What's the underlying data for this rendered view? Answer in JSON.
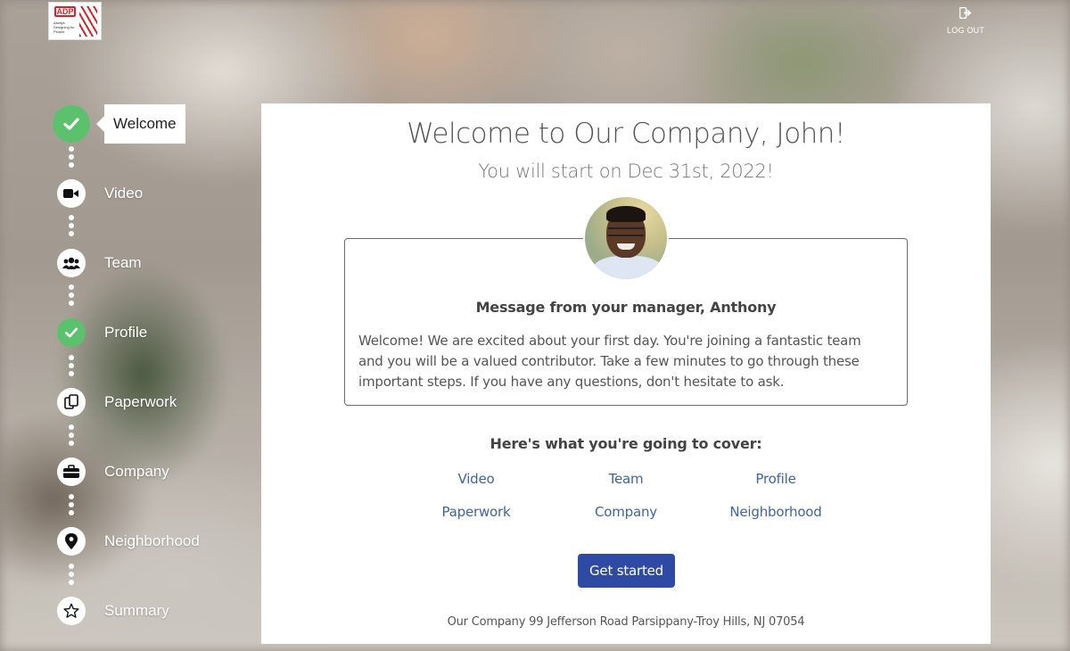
{
  "header": {
    "logo_text": "ADP",
    "logo_tagline": "Always Designing for People",
    "logout_label": "LOG OUT"
  },
  "sidebar": {
    "steps": [
      {
        "label": "Welcome",
        "icon": "check-icon",
        "state": "active-done"
      },
      {
        "label": "Video",
        "icon": "video-camera-icon",
        "state": "todo"
      },
      {
        "label": "Team",
        "icon": "users-icon",
        "state": "todo"
      },
      {
        "label": "Profile",
        "icon": "check-icon",
        "state": "done"
      },
      {
        "label": "Paperwork",
        "icon": "documents-icon",
        "state": "todo"
      },
      {
        "label": "Company",
        "icon": "briefcase-icon",
        "state": "todo"
      },
      {
        "label": "Neighborhood",
        "icon": "map-pin-icon",
        "state": "todo"
      },
      {
        "label": "Summary",
        "icon": "star-icon",
        "state": "todo"
      }
    ]
  },
  "main": {
    "title": "Welcome to Our Company, John!",
    "subtitle": "You will start on Dec 31st, 2022!",
    "message": {
      "heading": "Message from your manager, Anthony",
      "body": "Welcome! We are excited about your first day. You're joining a fantastic team and you will be a valued contributor. Take a few minutes to go through these important steps. If you have any questions, don't hesitate to ask."
    },
    "cover": {
      "heading": "Here's what you're going to cover:",
      "links": [
        "Video",
        "Team",
        "Profile",
        "Paperwork",
        "Company",
        "Neighborhood"
      ]
    },
    "get_started_label": "Get started",
    "footer": "Our Company 99 Jefferson Road Parsippany-Troy Hills, NJ 07054"
  },
  "colors": {
    "done_green": "#5cc16d",
    "link_blue": "#3e63a6",
    "button_blue": "#2f4aa4"
  }
}
